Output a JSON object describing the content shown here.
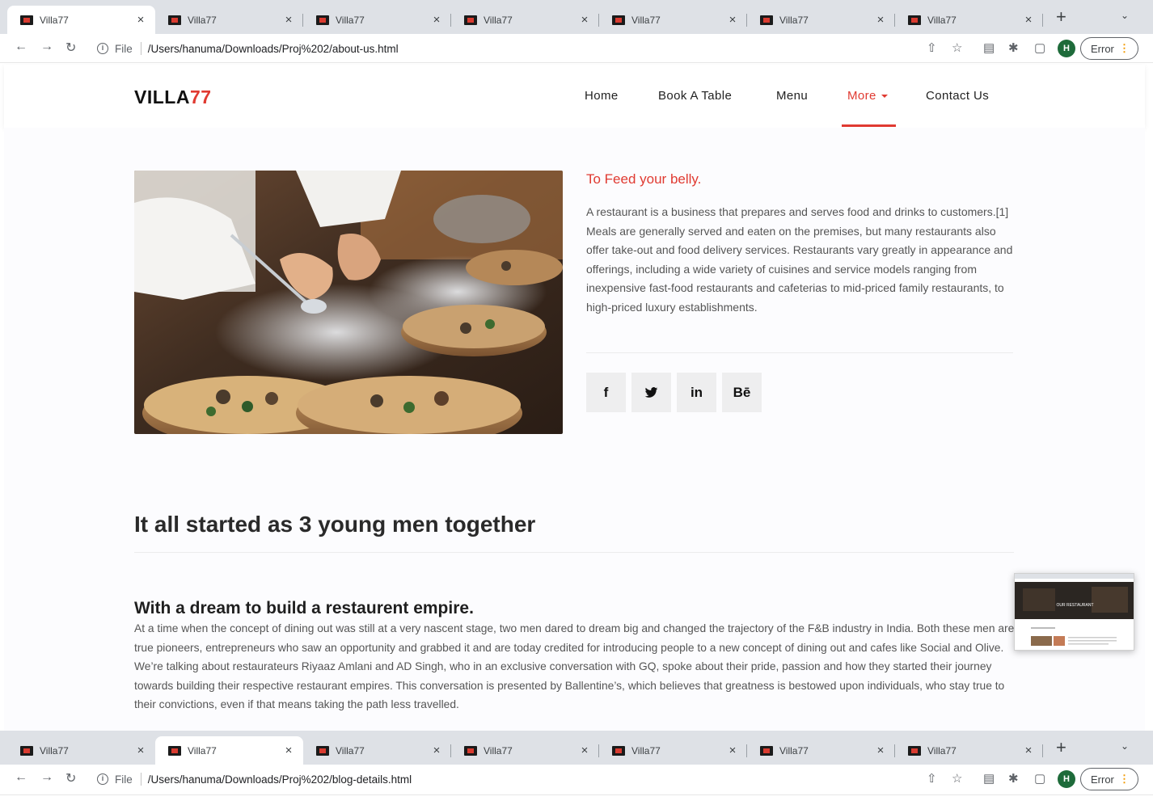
{
  "browser_top": {
    "tabs": [
      {
        "title": "Villa77",
        "active": true
      },
      {
        "title": "Villa77",
        "active": false
      },
      {
        "title": "Villa77",
        "active": false
      },
      {
        "title": "Villa77",
        "active": false
      },
      {
        "title": "Villa77",
        "active": false
      },
      {
        "title": "Villa77",
        "active": false
      },
      {
        "title": "Villa77",
        "active": false
      }
    ],
    "scheme_label": "File",
    "url": "/Users/hanuma/Downloads/Proj%202/about-us.html",
    "profile_initial": "H",
    "error_label": "Error"
  },
  "browser_bottom": {
    "tabs": [
      {
        "title": "Villa77",
        "active": false
      },
      {
        "title": "Villa77",
        "active": true
      },
      {
        "title": "Villa77",
        "active": false
      },
      {
        "title": "Villa77",
        "active": false
      },
      {
        "title": "Villa77",
        "active": false
      },
      {
        "title": "Villa77",
        "active": false
      },
      {
        "title": "Villa77",
        "active": false
      }
    ],
    "scheme_label": "File",
    "url": "/Users/hanuma/Downloads/Proj%202/blog-details.html",
    "profile_initial": "H",
    "error_label": "Error"
  },
  "site": {
    "logo_main": "VILLA",
    "logo_accent": "77",
    "nav": {
      "home": "Home",
      "book": "Book A Table",
      "menu": "Menu",
      "more": "More",
      "contact": "Contact Us"
    },
    "accent_color": "#e03a31"
  },
  "about": {
    "tagline": "To Feed your belly.",
    "description": "A restaurant is a business that prepares and serves food and drinks to customers.[1] Meals are generally served and eaten on the premises, but many restaurants also offer take-out and food delivery services. Restaurants vary greatly in appearance and offerings, including a wide variety of cuisines and service models ranging from inexpensive fast-food restaurants and cafeterias to mid-priced family restaurants, to high-priced luxury establishments.",
    "social": {
      "facebook": "f",
      "linkedin": "in",
      "behance": "Bē"
    }
  },
  "story": {
    "heading": "It all started as 3 young men together",
    "subheading": "With a dream to build a restaurent empire.",
    "body": "At a time when the concept of dining out was still at a very nascent stage, two men dared to dream big and changed the trajectory of the F&B industry in India. Both these men are true pioneers, entrepreneurs who saw an opportunity and grabbed it and are today credited for introducing people to a new concept of dining out and cafes like Social and Olive. We’re talking about restaurateurs Riyaaz Amlani and AD Singh, who in an exclusive conversation with GQ, spoke about their pride, passion and how they started their journey towards building their respective restaurant empires. This conversation is presented by Ballentine’s, which believes that greatness is bestowed upon individuals, who stay true to their convictions, even if that means taking the path less travelled."
  },
  "preview_thumbnail": {
    "banner_text": "OUR RESTAURANT"
  }
}
